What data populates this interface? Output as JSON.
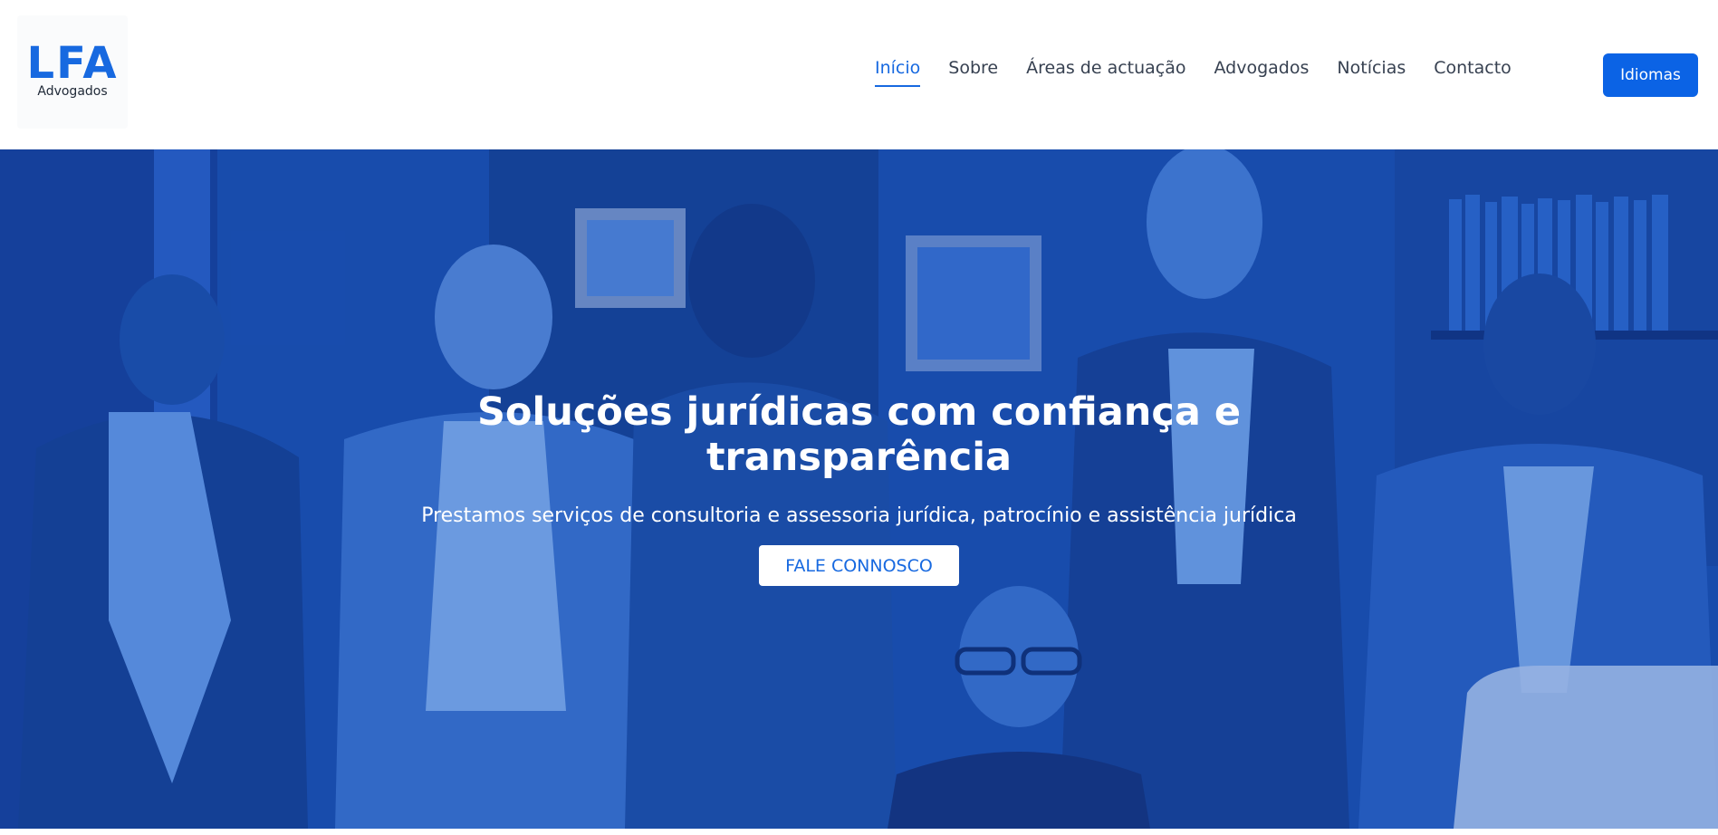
{
  "logo": {
    "mark": "LFA",
    "subtitle": "Advogados"
  },
  "nav": {
    "items": [
      {
        "label": "Início",
        "active": true
      },
      {
        "label": "Sobre"
      },
      {
        "label": "Áreas de actuação"
      },
      {
        "label": "Advogados"
      },
      {
        "label": "Notícias"
      },
      {
        "label": "Contacto"
      }
    ]
  },
  "language_button": "Idiomas",
  "hero": {
    "title": "Soluções jurídicas com confiança e transparência",
    "subtitle": "Prestamos serviços de consultoria e assessoria jurídica, patrocínio e assistência jurídica",
    "cta": "FALE CONNOSCO"
  },
  "colors": {
    "brand": "#1769e0",
    "button": "#0b63e5",
    "hero_tint": "#1a4fb3"
  }
}
